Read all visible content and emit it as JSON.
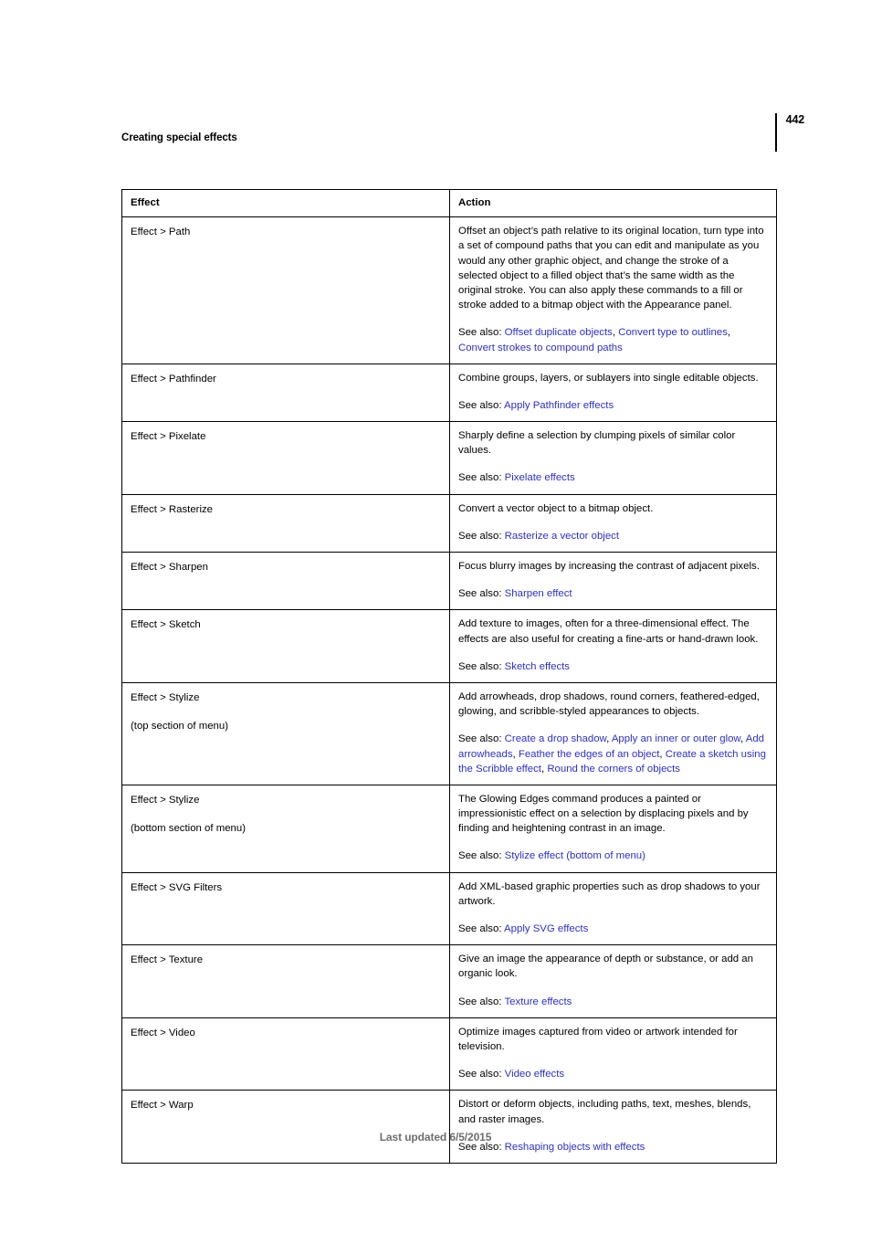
{
  "header": {
    "running_head": "Creating special effects",
    "page_number": "442"
  },
  "table": {
    "columns": [
      "Effect",
      "Action"
    ],
    "rows": [
      {
        "effect": "Effect > Path",
        "effect_sub": "",
        "description": "Offset an object’s path relative to its original location, turn type into a set of compound paths that you can edit and manipulate as you would any other graphic object, and change the stroke of a selected object to a filled object that’s the same width as the original stroke. You can also apply these commands to a fill or stroke added to a bitmap object with the Appearance panel.",
        "see_also_label": "See also:",
        "links": [
          "Offset duplicate objects",
          "Convert type to outlines",
          "Convert strokes to compound paths"
        ]
      },
      {
        "effect": "Effect > Pathfinder",
        "effect_sub": "",
        "description": "Combine groups, layers, or sublayers into single editable objects.",
        "see_also_label": "See also:",
        "links": [
          "Apply Pathfinder effects"
        ]
      },
      {
        "effect": "Effect > Pixelate",
        "effect_sub": "",
        "description": "Sharply define a selection by clumping pixels of similar color values.",
        "see_also_label": "See also:",
        "links": [
          "Pixelate effects"
        ]
      },
      {
        "effect": "Effect > Rasterize",
        "effect_sub": "",
        "description": "Convert a vector object to a bitmap object.",
        "see_also_label": "See also:",
        "links": [
          "Rasterize a vector object"
        ]
      },
      {
        "effect": "Effect > Sharpen",
        "effect_sub": "",
        "description": "Focus blurry images by increasing the contrast of adjacent pixels.",
        "see_also_label": "See also:",
        "links": [
          "Sharpen effect"
        ]
      },
      {
        "effect": "Effect > Sketch",
        "effect_sub": "",
        "description": "Add texture to images, often for a three-dimensional effect. The effects are also useful for creating a fine-arts or hand-drawn look.",
        "see_also_label": "See also:",
        "links": [
          "Sketch effects"
        ]
      },
      {
        "effect": "Effect > Stylize",
        "effect_sub": "(top section of menu)",
        "description": "Add arrowheads, drop shadows, round corners, feathered-edged, glowing, and scribble-styled appearances to objects.",
        "see_also_label": "See also:",
        "links": [
          "Create a drop shadow",
          "Apply an inner or outer glow",
          "Add arrowheads",
          "Feather the edges of an object",
          "Create a sketch using the Scribble effect",
          "Round the corners of objects"
        ]
      },
      {
        "effect": "Effect > Stylize",
        "effect_sub": "(bottom section of menu)",
        "description": "The Glowing Edges command produces a painted or impressionistic effect on a selection by displacing pixels and by finding and heightening contrast in an image.",
        "see_also_label": "See also:",
        "links": [
          "Stylize effect (bottom of menu)"
        ]
      },
      {
        "effect": "Effect > SVG Filters",
        "effect_sub": "",
        "description": "Add XML-based graphic properties such as drop shadows to your artwork.",
        "see_also_label": "See also:",
        "links": [
          "Apply SVG effects"
        ]
      },
      {
        "effect": "Effect > Texture",
        "effect_sub": "",
        "description": "Give an image the appearance of depth or substance, or add an organic look.",
        "see_also_label": "See also:",
        "links": [
          "Texture effects"
        ]
      },
      {
        "effect": "Effect > Video",
        "effect_sub": "",
        "description": "Optimize images captured from video or artwork intended for television.",
        "see_also_label": "See also:",
        "links": [
          "Video effects"
        ]
      },
      {
        "effect": "Effect > Warp",
        "effect_sub": "",
        "description": "Distort or deform objects, including paths, text, meshes, blends, and raster images.",
        "see_also_label": "See also:",
        "links": [
          "Reshaping objects with effects"
        ]
      }
    ]
  },
  "footer": {
    "text": "Last updated 6/5/2015"
  },
  "colors": {
    "link": "#2c30d0",
    "text": "#000000",
    "footer_text": "#6e6e6e",
    "rule": "#000000"
  }
}
